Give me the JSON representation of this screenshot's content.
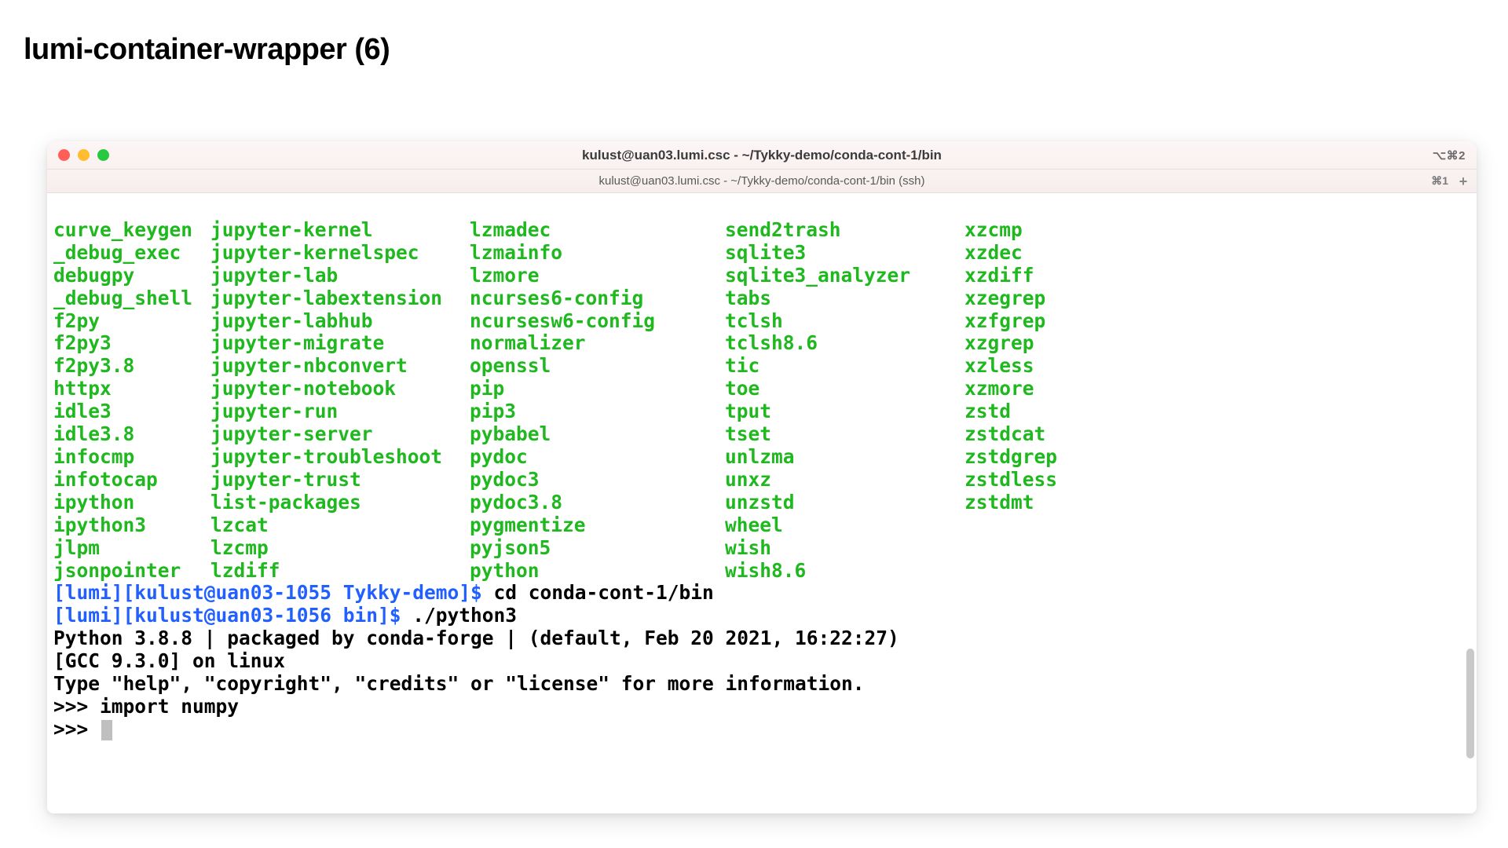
{
  "slide": {
    "title": "lumi-container-wrapper (6)"
  },
  "window": {
    "title": "kulust@uan03.lumi.csc - ~/Tykky-demo/conda-cont-1/bin",
    "right_label": "⌥⌘2",
    "tab_title": "kulust@uan03.lumi.csc - ~/Tykky-demo/conda-cont-1/bin (ssh)",
    "tab_right_label": "⌘1"
  },
  "file_columns": [
    [
      "curve_keygen",
      "_debug_exec",
      "debugpy",
      "_debug_shell",
      "f2py",
      "f2py3",
      "f2py3.8",
      "httpx",
      "idle3",
      "idle3.8",
      "infocmp",
      "infotocap",
      "ipython",
      "ipython3",
      "jlpm",
      "jsonpointer"
    ],
    [
      "jupyter-kernel",
      "jupyter-kernelspec",
      "jupyter-lab",
      "jupyter-labextension",
      "jupyter-labhub",
      "jupyter-migrate",
      "jupyter-nbconvert",
      "jupyter-notebook",
      "jupyter-run",
      "jupyter-server",
      "jupyter-troubleshoot",
      "jupyter-trust",
      "list-packages",
      "lzcat",
      "lzcmp",
      "lzdiff"
    ],
    [
      "lzmadec",
      "lzmainfo",
      "lzmore",
      "ncurses6-config",
      "ncursesw6-config",
      "normalizer",
      "openssl",
      "pip",
      "pip3",
      "pybabel",
      "pydoc",
      "pydoc3",
      "pydoc3.8",
      "pygmentize",
      "pyjson5",
      "python"
    ],
    [
      "send2trash",
      "sqlite3",
      "sqlite3_analyzer",
      "tabs",
      "tclsh",
      "tclsh8.6",
      "tic",
      "toe",
      "tput",
      "tset",
      "unlzma",
      "unxz",
      "unzstd",
      "wheel",
      "wish",
      "wish8.6"
    ],
    [
      "xzcmp",
      "xzdec",
      "xzdiff",
      "xzegrep",
      "xzfgrep",
      "xzgrep",
      "xzless",
      "xzmore",
      "zstd",
      "zstdcat",
      "zstdgrep",
      "zstdless",
      "zstdmt"
    ]
  ],
  "session": {
    "prompt1_prefix": "[lumi][kulust@uan03-1055 Tykky-demo]$ ",
    "prompt1_cmd": "cd conda-cont-1/bin",
    "prompt2_prefix": "[lumi][kulust@uan03-1056 bin]$ ",
    "prompt2_cmd": "./python3",
    "python_line1": "Python 3.8.8 | packaged by conda-forge | (default, Feb 20 2021, 16:22:27)",
    "python_line2": "[GCC 9.3.0] on linux",
    "python_line3": "Type \"help\", \"copyright\", \"credits\" or \"license\" for more information.",
    "repl1": ">>> import numpy",
    "repl2": ">>> "
  }
}
